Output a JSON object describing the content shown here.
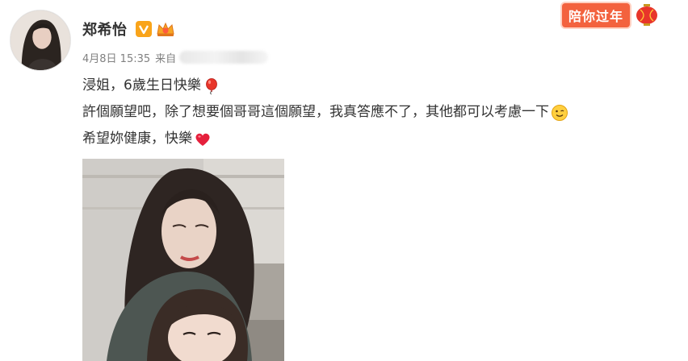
{
  "post": {
    "author": {
      "name": "郑希怡",
      "avatar": "avatar",
      "verified_icon": "verified-v-icon",
      "member_icon": "crown-member-icon"
    },
    "meta": {
      "time": "4月8日 15:35",
      "source_label": "来自"
    },
    "banner": {
      "text": "陪你过年",
      "icon": "lantern-icon",
      "bg_color": "#f3623e"
    },
    "lines": [
      {
        "text": "浸姐，6歲生日快樂",
        "emoji": "balloon-icon"
      },
      {
        "text": "許個願望吧，除了想要個哥哥這個願望，我真答應不了，其他都可以考慮一下",
        "emoji": "wink-face-icon"
      },
      {
        "text": "希望妳健康，快樂",
        "emoji": "red-heart-icon"
      }
    ],
    "photo": {
      "alt": "photo"
    }
  },
  "colors": {
    "accent": "#f9a41a",
    "text": "#333333",
    "meta": "#808080",
    "heart": "#e5203c"
  }
}
